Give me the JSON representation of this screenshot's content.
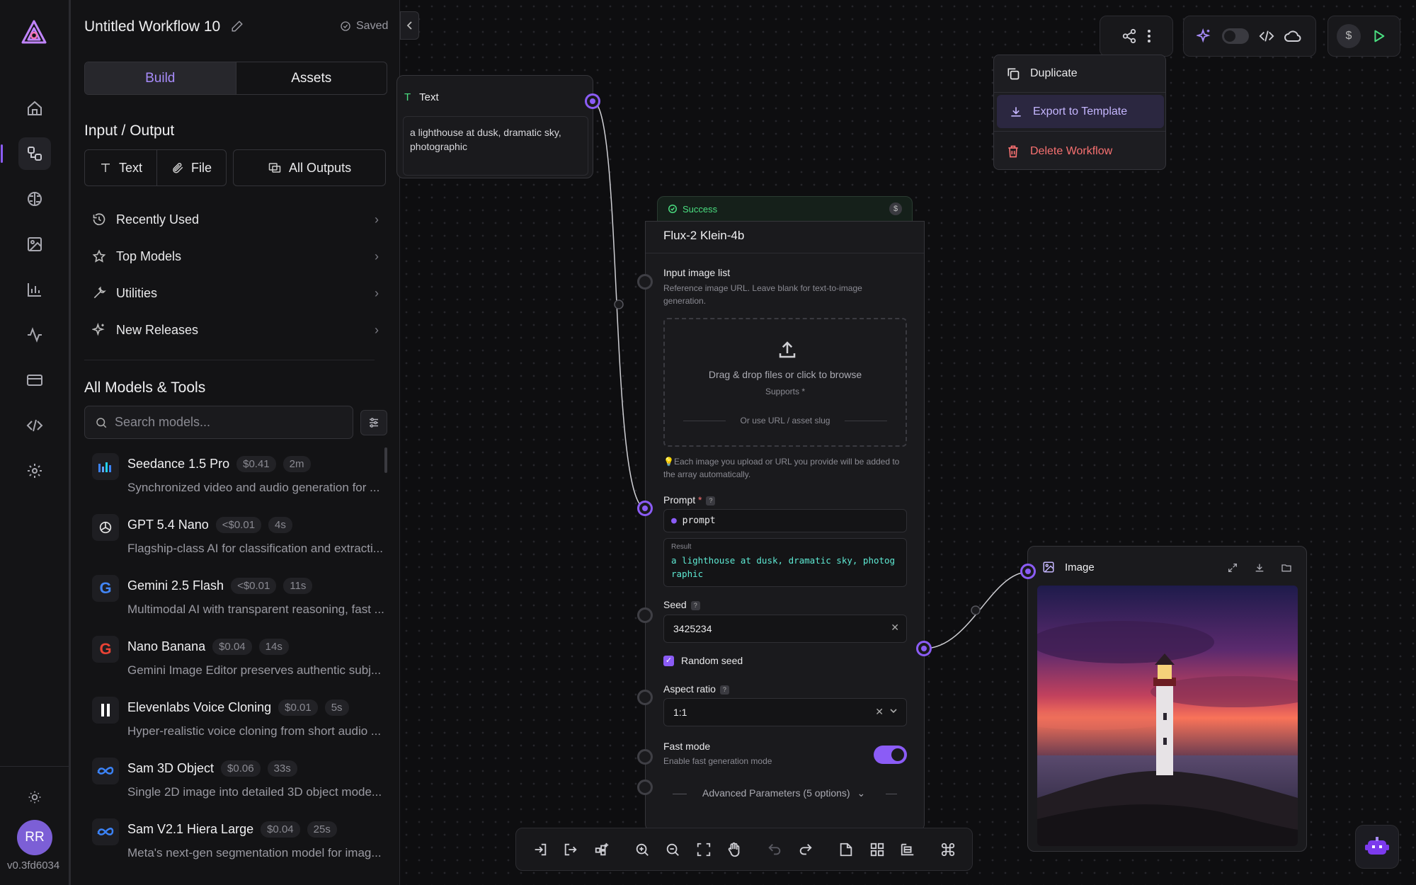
{
  "app": {
    "workflow_title": "Untitled Workflow 10",
    "save_status": "Saved",
    "version": "v0.3fd6034",
    "avatar_initials": "RR",
    "accent_color": "#8b5cf6"
  },
  "rail": {
    "items": [
      "home-icon",
      "workflow-icon",
      "brain-icon",
      "image-icon",
      "chart-icon",
      "activity-icon",
      "card-icon",
      "code-icon",
      "settings-icon"
    ],
    "active": "workflow-icon"
  },
  "sidebar": {
    "tabs": [
      "Build",
      "Assets"
    ],
    "active_tab": "Build",
    "io_title": "Input / Output",
    "io_buttons": {
      "text": "Text",
      "file": "File",
      "all_outputs": "All Outputs"
    },
    "nav": [
      "Recently Used",
      "Top Models",
      "Utilities",
      "New Releases"
    ],
    "models_title": "All Models & Tools",
    "search_placeholder": "Search models...",
    "models": [
      {
        "name": "Seedance 1.5 Pro",
        "price": "$0.41",
        "time": "2m",
        "desc": "Synchronized video and audio generation for ..."
      },
      {
        "name": "GPT 5.4 Nano",
        "price": "<$0.01",
        "time": "4s",
        "desc": "Flagship-class AI for classification and extracti..."
      },
      {
        "name": "Gemini 2.5 Flash",
        "price": "<$0.01",
        "time": "11s",
        "desc": "Multimodal AI with transparent reasoning, fast ..."
      },
      {
        "name": "Nano Banana",
        "price": "$0.04",
        "time": "14s",
        "desc": "Gemini Image Editor preserves authentic subj..."
      },
      {
        "name": "Elevenlabs Voice Cloning",
        "price": "$0.01",
        "time": "5s",
        "desc": "Hyper-realistic voice cloning from short audio ..."
      },
      {
        "name": "Sam 3D Object",
        "price": "$0.06",
        "time": "33s",
        "desc": "Single 2D image into detailed 3D object mode..."
      },
      {
        "name": "Sam V2.1 Hiera Large",
        "price": "$0.04",
        "time": "25s",
        "desc": "Meta's next-gen segmentation model for imag..."
      }
    ]
  },
  "text_node": {
    "title": "Text",
    "content": "a lighthouse at dusk, dramatic sky, photographic"
  },
  "flux_node": {
    "status": "Success",
    "title": "Flux-2 Klein-4b",
    "input_image_label": "Input image list",
    "input_image_help": "Reference image URL. Leave blank for text-to-image generation.",
    "drop_text": "Drag & drop files or click to browse",
    "supports": "Supports *",
    "or_url": "Or use URL / asset slug",
    "hint": "💡Each image you upload or URL you provide will be added to the array automatically.",
    "prompt_label": "Prompt",
    "prompt_required": "*",
    "prompt_chip": "prompt",
    "result_label": "Result",
    "result_value": "a lighthouse at dusk, dramatic sky, photog\nraphic",
    "seed_label": "Seed",
    "seed_value": "3425234",
    "random_seed_label": "Random seed",
    "random_seed_checked": true,
    "aspect_label": "Aspect ratio",
    "aspect_value": "1:1",
    "fast_mode_label": "Fast mode",
    "fast_mode_help": "Enable fast generation mode",
    "fast_mode_on": true,
    "advanced_label": "Advanced Parameters (5 options)"
  },
  "image_node": {
    "title": "Image"
  },
  "menu": {
    "items": [
      "Duplicate",
      "Export to Template",
      "Delete Workflow"
    ],
    "highlighted": "Export to Template"
  },
  "toolbar": {
    "cost_symbol": "$"
  }
}
